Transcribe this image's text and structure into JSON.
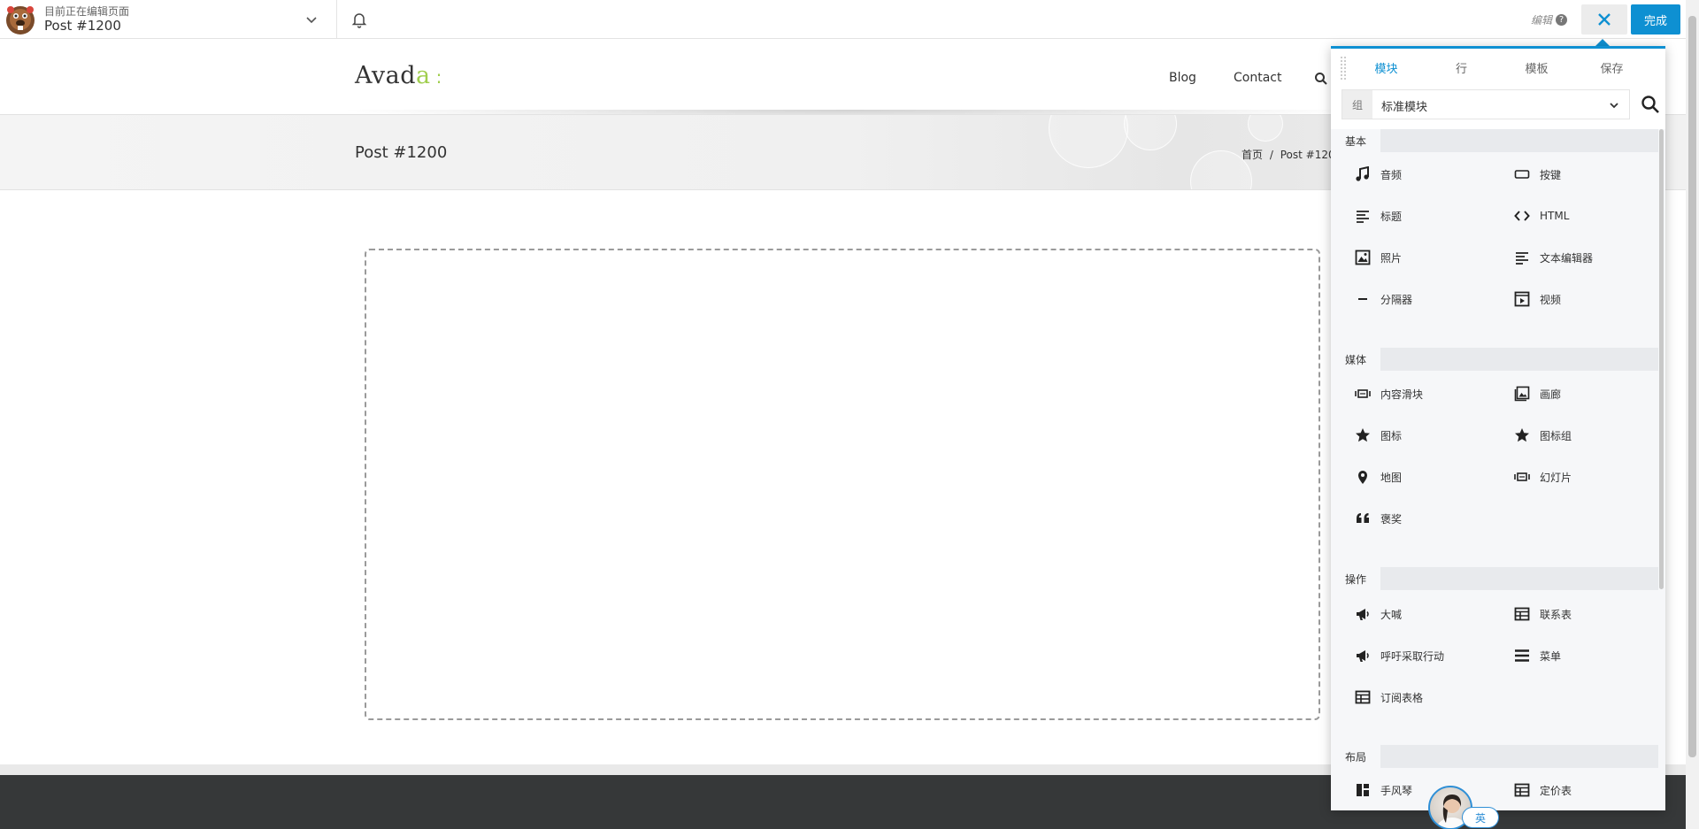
{
  "builder": {
    "editing_caption": "目前正在编辑页面",
    "page_name": "Post #1200",
    "edit_label": "编辑",
    "help_glyph": "?",
    "done_label": "完成"
  },
  "site": {
    "logo_main": "Avad",
    "logo_accent": "a",
    "logo_colon": ":",
    "nav": [
      "Blog",
      "Contact"
    ],
    "page_title": "Post #1200",
    "breadcrumb_home": "首页",
    "breadcrumb_sep": "/",
    "breadcrumb_current": "Post #1200"
  },
  "panel": {
    "tabs": [
      "模块",
      "行",
      "模板",
      "保存"
    ],
    "active_tab": "模块",
    "group_label": "组",
    "group_value": "标准模块",
    "sections": [
      {
        "title": "基本",
        "modules": [
          {
            "label": "音频",
            "icon": "music-note-icon"
          },
          {
            "label": "按键",
            "icon": "button-icon"
          },
          {
            "label": "标题",
            "icon": "heading-icon"
          },
          {
            "label": "HTML",
            "icon": "code-icon"
          },
          {
            "label": "照片",
            "icon": "photo-icon"
          },
          {
            "label": "文本编辑器",
            "icon": "text-editor-icon"
          },
          {
            "label": "分隔器",
            "icon": "separator-icon"
          },
          {
            "label": "视频",
            "icon": "video-icon"
          }
        ]
      },
      {
        "title": "媒体",
        "modules": [
          {
            "label": "内容滑块",
            "icon": "slider-icon"
          },
          {
            "label": "画廊",
            "icon": "gallery-icon"
          },
          {
            "label": "图标",
            "icon": "star-icon"
          },
          {
            "label": "图标组",
            "icon": "star-icon"
          },
          {
            "label": "地图",
            "icon": "map-pin-icon"
          },
          {
            "label": "幻灯片",
            "icon": "slider-icon"
          },
          {
            "label": "褒奖",
            "icon": "quote-icon"
          }
        ]
      },
      {
        "title": "操作",
        "modules": [
          {
            "label": "大喊",
            "icon": "megaphone-icon"
          },
          {
            "label": "联系表",
            "icon": "table-icon"
          },
          {
            "label": "呼吁采取行动",
            "icon": "megaphone-icon"
          },
          {
            "label": "菜单",
            "icon": "menu-icon"
          },
          {
            "label": "订阅表格",
            "icon": "table-icon"
          }
        ]
      },
      {
        "title": "布局",
        "modules": [
          {
            "label": "手风琴",
            "icon": "accordion-icon"
          },
          {
            "label": "定价表",
            "icon": "table-icon"
          }
        ]
      }
    ]
  },
  "overlay": {
    "lang_badge": "英"
  },
  "colors": {
    "accent": "#0e90d2",
    "logo_accent": "#a0ce4e",
    "footer": "#363839"
  }
}
